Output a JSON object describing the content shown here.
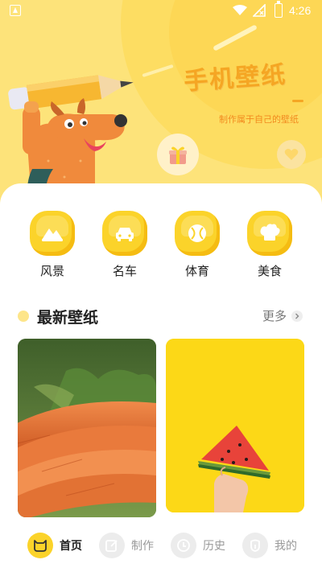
{
  "status_bar": {
    "time": "4:26"
  },
  "hero": {
    "title": "手机壁纸",
    "subtitle": "制作属于自己的壁纸"
  },
  "categories": [
    {
      "label": "风景",
      "icon": "mountain-icon"
    },
    {
      "label": "名车",
      "icon": "car-icon"
    },
    {
      "label": "体育",
      "icon": "ball-icon"
    },
    {
      "label": "美食",
      "icon": "chef-hat-icon"
    }
  ],
  "latest": {
    "title": "最新壁纸",
    "more_label": "更多"
  },
  "wallpapers": [
    {
      "subject": "carrots"
    },
    {
      "subject": "watermelon"
    }
  ],
  "nav": [
    {
      "label": "首页",
      "icon": "cat-icon",
      "active": true
    },
    {
      "label": "制作",
      "icon": "edit-icon",
      "active": false
    },
    {
      "label": "历史",
      "icon": "clock-icon",
      "active": false
    },
    {
      "label": "我的",
      "icon": "profile-icon",
      "active": false
    }
  ],
  "colors": {
    "accent": "#fbd32a",
    "hero_bg": "#fde37a",
    "title_orange": "#f5a623"
  }
}
